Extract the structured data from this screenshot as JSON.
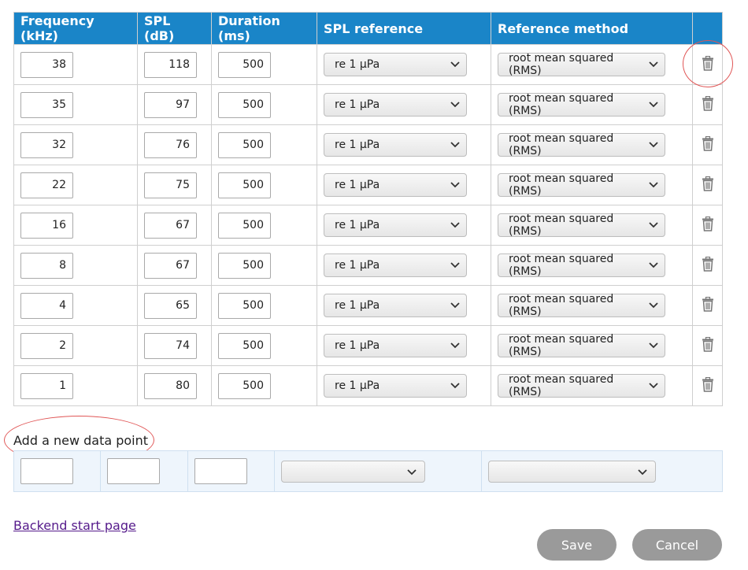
{
  "table": {
    "headers": [
      "Frequency (kHz)",
      "SPL (dB)",
      "Duration (ms)",
      "SPL reference",
      "Reference method",
      ""
    ],
    "rows": [
      {
        "frequency": "38",
        "spl": "118",
        "duration": "500",
        "spl_reference": "re 1 µPa",
        "reference_method": "root mean squared (RMS)"
      },
      {
        "frequency": "35",
        "spl": "97",
        "duration": "500",
        "spl_reference": "re 1 µPa",
        "reference_method": "root mean squared (RMS)"
      },
      {
        "frequency": "32",
        "spl": "76",
        "duration": "500",
        "spl_reference": "re 1 µPa",
        "reference_method": "root mean squared (RMS)"
      },
      {
        "frequency": "22",
        "spl": "75",
        "duration": "500",
        "spl_reference": "re 1 µPa",
        "reference_method": "root mean squared (RMS)"
      },
      {
        "frequency": "16",
        "spl": "67",
        "duration": "500",
        "spl_reference": "re 1 µPa",
        "reference_method": "root mean squared (RMS)"
      },
      {
        "frequency": "8",
        "spl": "67",
        "duration": "500",
        "spl_reference": "re 1 µPa",
        "reference_method": "root mean squared (RMS)"
      },
      {
        "frequency": "4",
        "spl": "65",
        "duration": "500",
        "spl_reference": "re 1 µPa",
        "reference_method": "root mean squared (RMS)"
      },
      {
        "frequency": "2",
        "spl": "74",
        "duration": "500",
        "spl_reference": "re 1 µPa",
        "reference_method": "root mean squared (RMS)"
      },
      {
        "frequency": "1",
        "spl": "80",
        "duration": "500",
        "spl_reference": "re 1 µPa",
        "reference_method": "root mean squared (RMS)"
      }
    ],
    "row_action_icon": "trash-icon"
  },
  "new_point": {
    "title": "Add a new data point",
    "frequency": "",
    "spl": "",
    "duration": "",
    "spl_reference": "",
    "reference_method": ""
  },
  "footer": {
    "backend_link": "Backend start page",
    "save_label": "Save",
    "cancel_label": "Cancel"
  },
  "colors": {
    "header_bg": "#1a85c8",
    "button_bg": "#9a9a9a",
    "annotation": "#e05555",
    "link": "#551a8b"
  }
}
